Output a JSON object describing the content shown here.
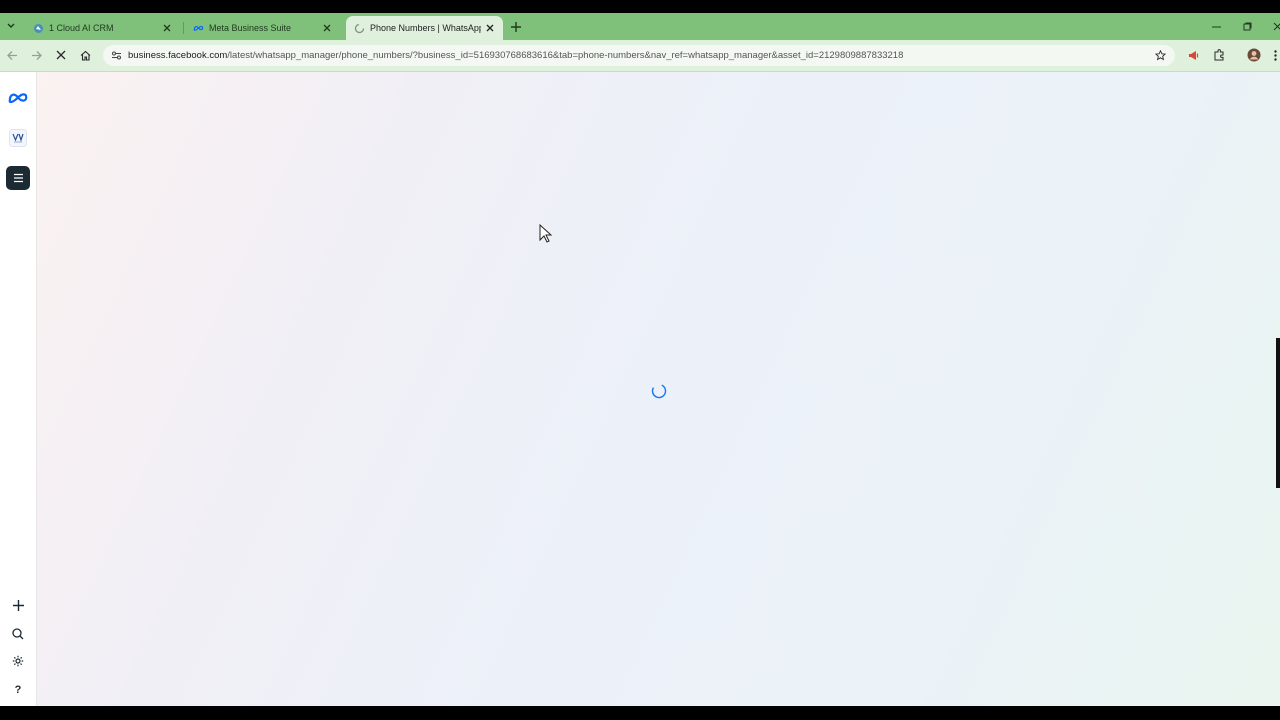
{
  "tabs": [
    {
      "title": "1 Cloud AI CRM",
      "active": false
    },
    {
      "title": "Meta Business Suite",
      "active": false
    },
    {
      "title": "Phone Numbers | WhatsApp M",
      "active": true
    }
  ],
  "address_bar": {
    "host": "business.facebook.com",
    "path": "/latest/whatsapp_manager/phone_numbers/?business_id=516930768683616&tab=phone-numbers&nav_ref=whatsapp_manager&asset_id=2129809887833218"
  },
  "sidebar": {
    "logo": "meta-logo-icon",
    "business_avatar": "business-avatar",
    "bottom_items": [
      "plus-icon",
      "search-icon",
      "gear-icon",
      "help-icon"
    ],
    "help_label": "?"
  },
  "colors": {
    "tabstrip": "#7fc07a",
    "toolbar": "#dff0dc",
    "meta_blue": "#0866ff",
    "spinner": "#1877f2",
    "sidebar_menu": "#1c2b33"
  },
  "page_state": "loading"
}
